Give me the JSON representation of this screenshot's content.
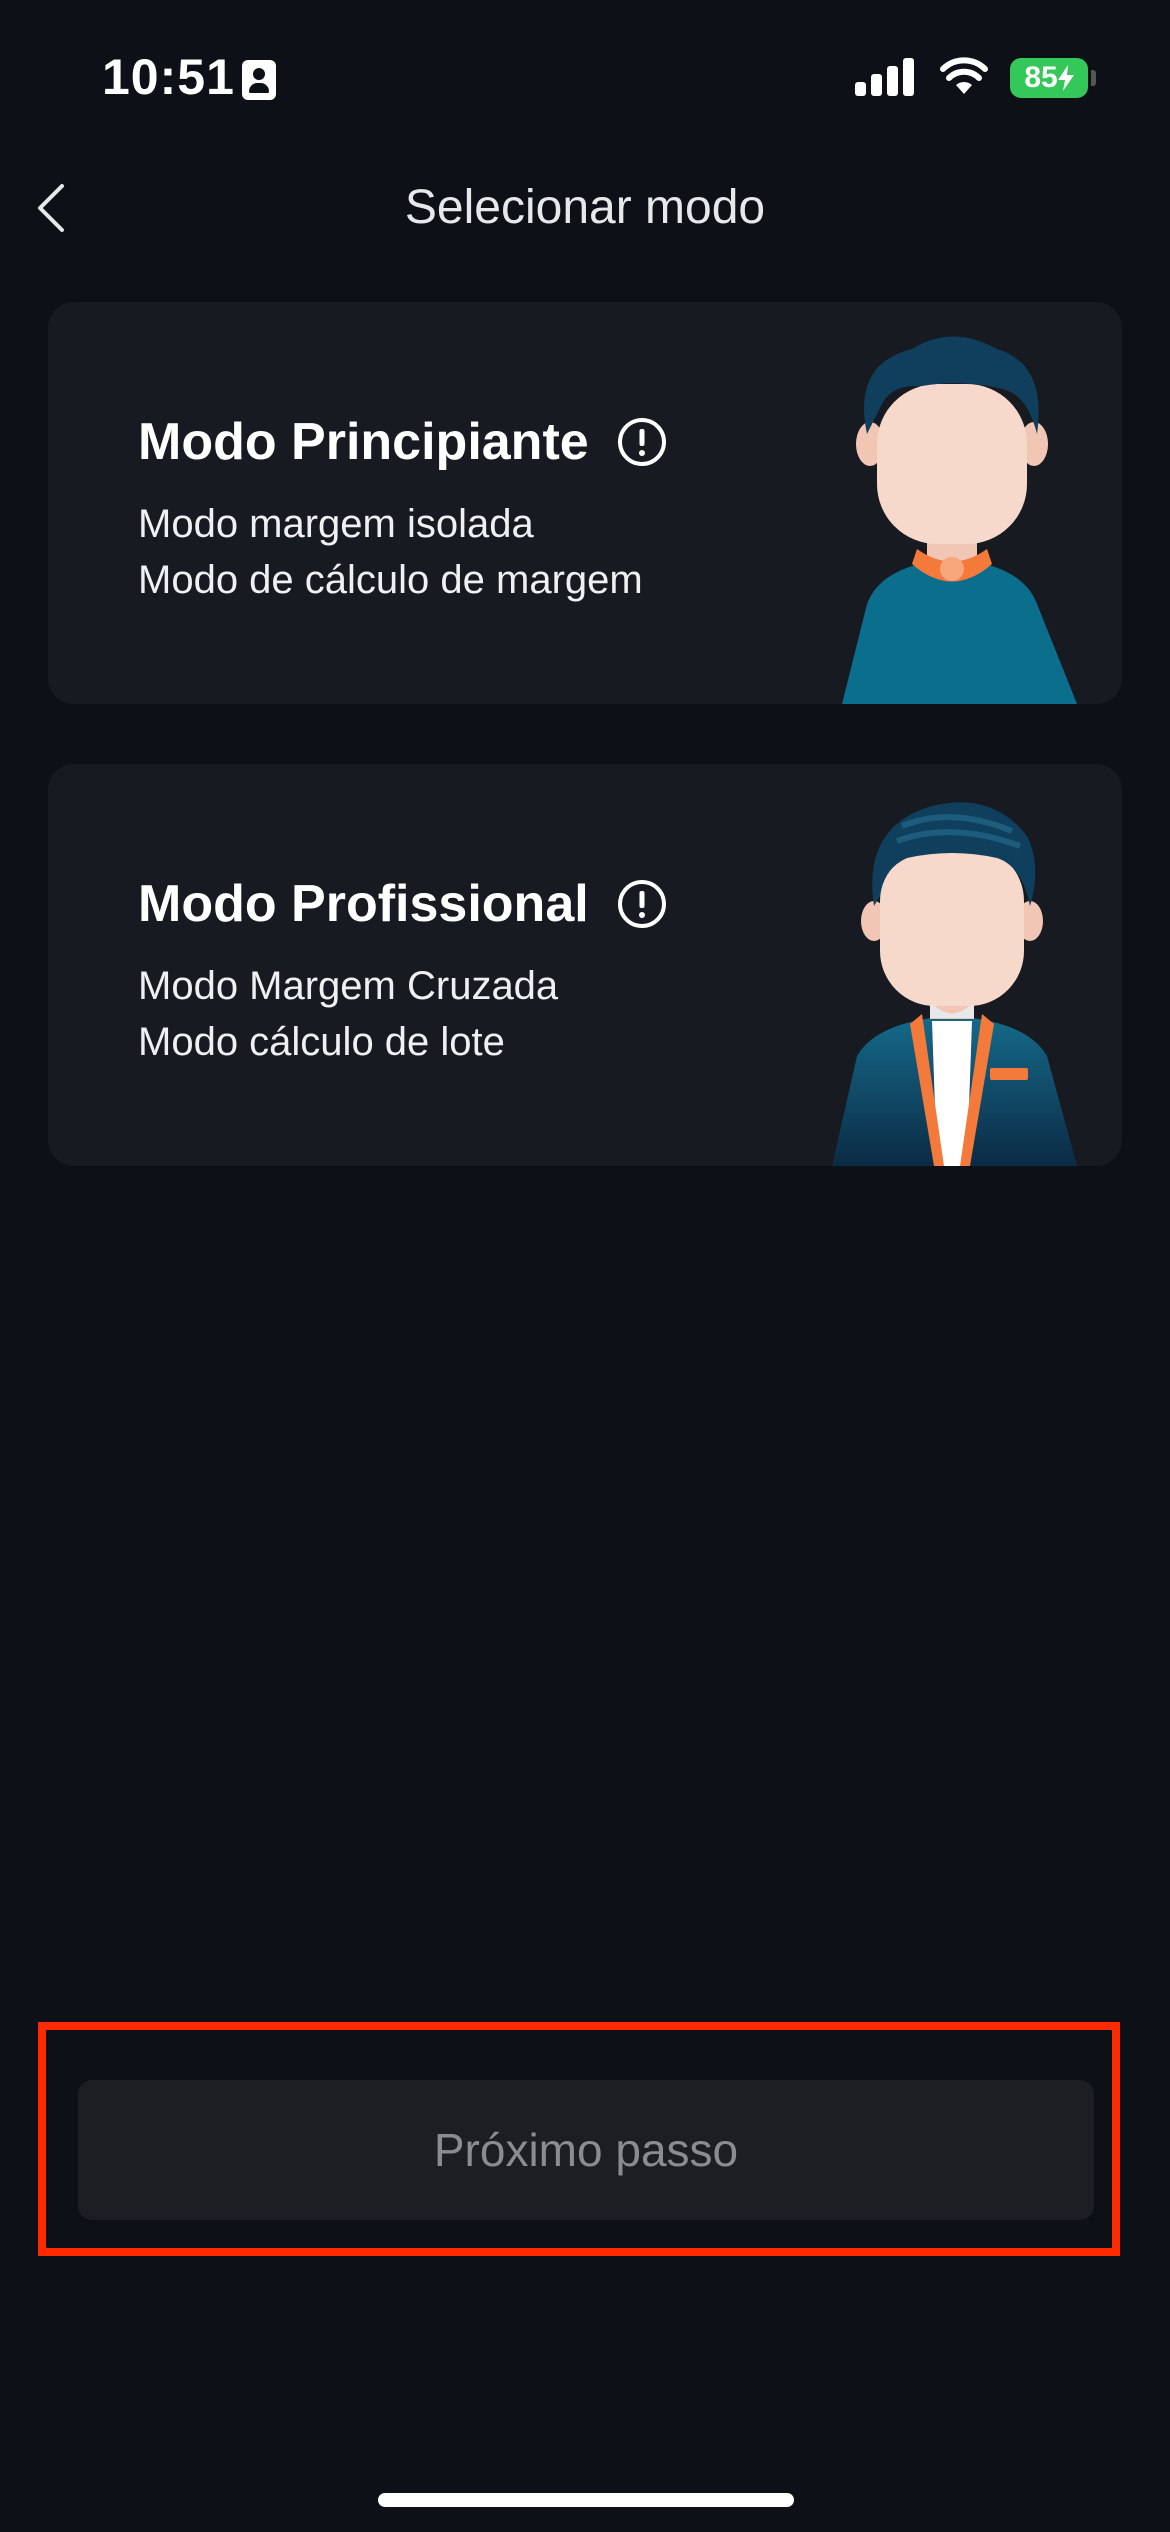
{
  "status_bar": {
    "time": "10:51",
    "battery": "85",
    "battery_color": "#34c759"
  },
  "nav": {
    "back_icon": "chevron-left-icon",
    "title": "Selecionar modo"
  },
  "modes": [
    {
      "title": "Modo Principiante",
      "lines": [
        "Modo margem isolada",
        "Modo de cálculo de margem"
      ],
      "info_icon": "info-circle-icon"
    },
    {
      "title": "Modo Profissional",
      "lines": [
        "Modo Margem Cruzada",
        "Modo cálculo de lote"
      ],
      "info_icon": "info-circle-icon"
    }
  ],
  "footer": {
    "next_label": "Próximo passo"
  },
  "colors": {
    "background": "#0d1017",
    "card": "#171a21",
    "highlight": "#ff2a00",
    "accent_orange": "#f47a3c",
    "accent_teal": "#0b6e8c"
  }
}
